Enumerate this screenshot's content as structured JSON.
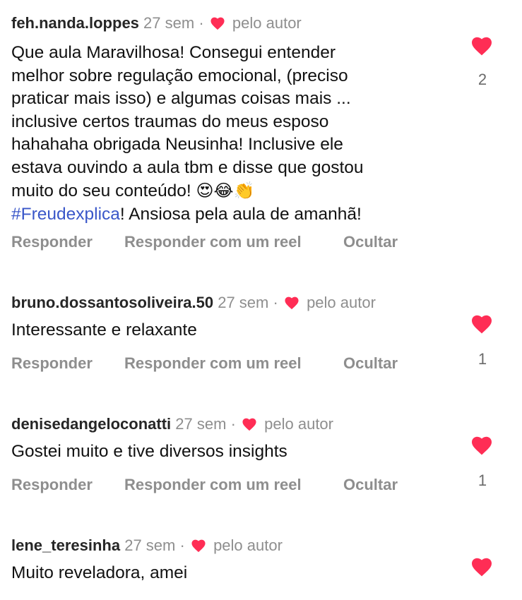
{
  "comments": [
    {
      "username": "feh.nanda.loppes",
      "time": "27 sem",
      "separator": "·",
      "by_author": "pelo autor",
      "text_lines": [
        "Que aula Maravilhosa! Consegui entender",
        "melhor sobre regulação emocional, (preciso",
        "praticar mais isso) e algumas coisas mais ...",
        "inclusive certos traumas do meus esposo",
        "hahahaha obrigada Neusinha!  Inclusive ele",
        "estava ouvindo a aula tbm e disse que gostou",
        "muito do seu conteúdo!"
      ],
      "emojis": "😍😂👏",
      "hashtag": "#Freudexplica",
      "after_hashtag": "! Ansiosa pela aula de amanhã!",
      "likes": "2"
    },
    {
      "username": "bruno.dossantosoliveira.50",
      "time": "27 sem",
      "separator": "·",
      "by_author": "pelo autor",
      "text": "Interessante e relaxante",
      "likes": "1"
    },
    {
      "username": "denisedangeloconatti",
      "time": "27 sem",
      "separator": "·",
      "by_author": "pelo autor",
      "text": "Gostei muito e tive diversos insights",
      "likes": "1"
    },
    {
      "username": "lene_teresinha",
      "time": "27 sem",
      "separator": "·",
      "by_author": "pelo autor",
      "text": "Muito reveladora, amei",
      "likes": ""
    }
  ],
  "actions": {
    "reply": "Responder",
    "reel": "Responder com um reel",
    "hide": "Ocultar"
  },
  "colors": {
    "heart": "#ff2d55",
    "muted": "#8e8e8e",
    "hashtag": "#3a57c9"
  },
  "icons": {
    "like": "heart-icon",
    "author_like": "small-heart-icon"
  }
}
